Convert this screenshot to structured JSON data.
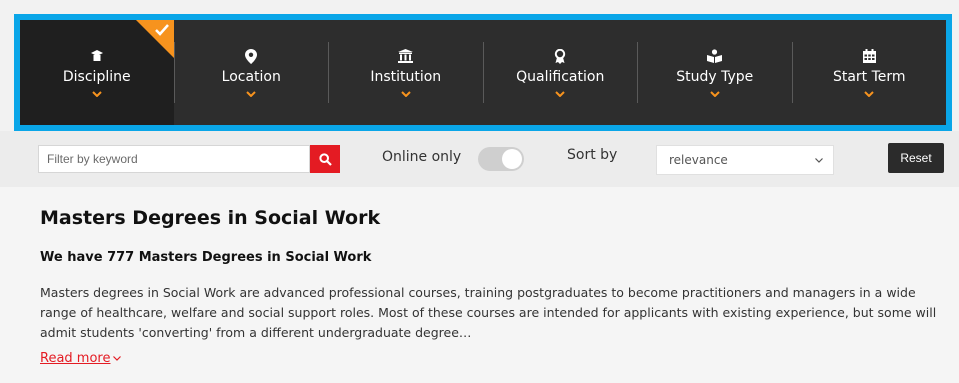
{
  "nav": {
    "items": [
      {
        "label": "Discipline",
        "icon": "graduation-cap-icon",
        "active": true
      },
      {
        "label": "Location",
        "icon": "map-pin-icon"
      },
      {
        "label": "Institution",
        "icon": "institution-icon"
      },
      {
        "label": "Qualification",
        "icon": "award-icon"
      },
      {
        "label": "Study Type",
        "icon": "reader-icon"
      },
      {
        "label": "Start Term",
        "icon": "calendar-icon"
      }
    ]
  },
  "filters": {
    "keyword_placeholder": "Filter by keyword",
    "online_label": "Online only",
    "sort_label": "Sort by",
    "sort_value": "relevance",
    "reset_label": "Reset"
  },
  "content": {
    "title": "Masters Degrees in Social Work",
    "subtitle": "We have 777 Masters Degrees in Social Work",
    "description": "Masters degrees in Social Work are advanced professional courses, training postgraduates to become practitioners and managers in a wide range of healthcare, welfare and social support roles. Most of these courses are intended for applicants with existing experience, but some will admit students 'converting' from a different undergraduate degree…",
    "read_more": "Read more"
  },
  "colors": {
    "navbar": "#2d2d2d",
    "accent_orange": "#f7931e",
    "brand_red": "#e41b23",
    "highlight_blue": "#0aa6e8"
  }
}
